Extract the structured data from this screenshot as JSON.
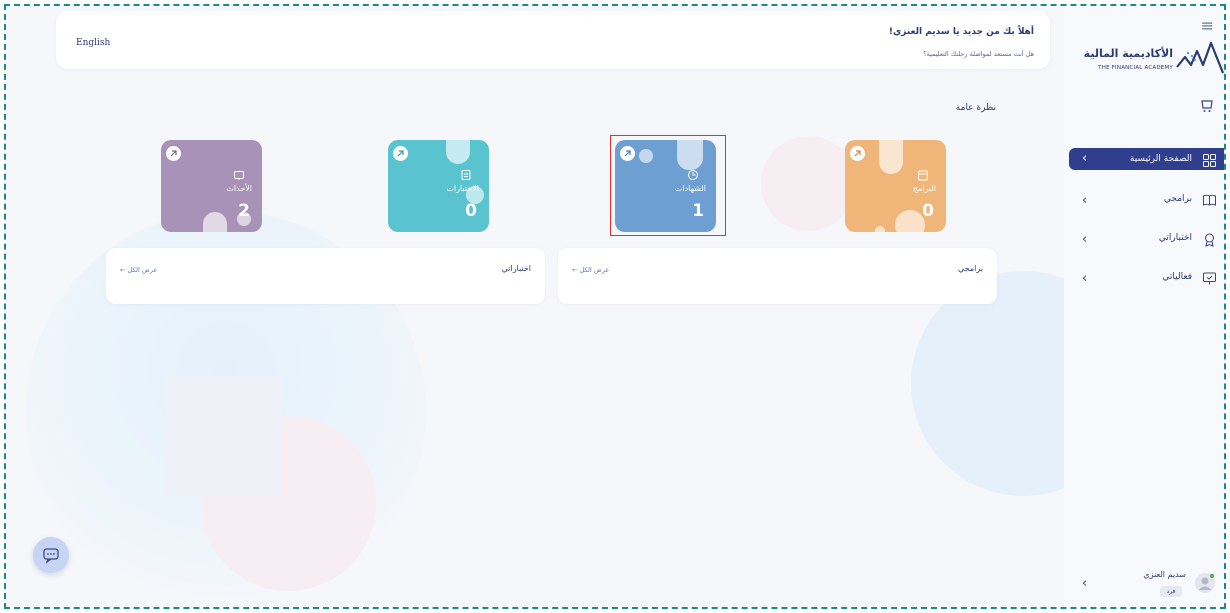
{
  "header": {
    "language_label": "English",
    "welcome_title": "أهلاً بك من جديد يا سديم العنزي!",
    "welcome_subtitle": "هل أنت مستعد لمواصلة رحلتك التعليمية؟"
  },
  "brand": {
    "name_ar": "الأكاديمية المالية",
    "name_en": "THE FINANCIAL ACADEMY",
    "logo_icon": "academy-logo-mark"
  },
  "sidebar": {
    "items": [
      {
        "label": "الصفحة الرئيسية",
        "icon": "grid-icon",
        "active": true
      },
      {
        "label": "برامجي",
        "icon": "book-icon",
        "active": false
      },
      {
        "label": "اختباراتي",
        "icon": "award-icon",
        "active": false
      },
      {
        "label": "فعالياتي",
        "icon": "presentation-icon",
        "active": false
      }
    ],
    "user": {
      "name": "سديم العنزي",
      "role": "فرد"
    }
  },
  "overview": {
    "title": "نظرة عامة",
    "cards": [
      {
        "label": "البرامج",
        "value": "0",
        "color": "#f0b679"
      },
      {
        "label": "الشهادات",
        "value": "1",
        "color": "#6d9fd3"
      },
      {
        "label": "الاختبارات",
        "value": "0",
        "color": "#59c3d0"
      },
      {
        "label": "الأحداث",
        "value": "2",
        "color": "#a892b8"
      }
    ]
  },
  "panels": [
    {
      "title": "برامجي",
      "link": "عرض الكل ←"
    },
    {
      "title": "اختباراتي",
      "link": "عرض الكل ←"
    }
  ],
  "colors": {
    "sidebar_active": "#2f3f8d",
    "highlight_border": "#d9342f",
    "text_primary": "#2b3b73"
  }
}
